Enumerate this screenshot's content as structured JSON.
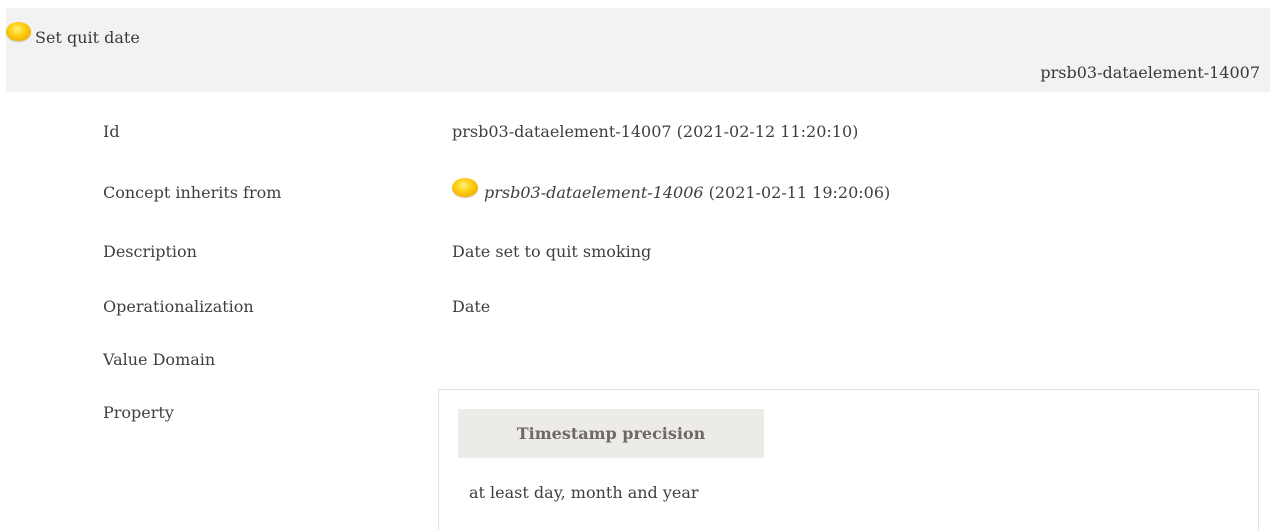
{
  "header": {
    "title": "Set quit date",
    "icon": "status-dot-icon",
    "icon_color": "#ffd21a",
    "ref_id": "prsb03-dataelement-14007"
  },
  "fields": {
    "id": {
      "label": "Id",
      "value": "prsb03-dataelement-14007 (2021-02-12 11:20:10)"
    },
    "inherits": {
      "label": "Concept inherits from",
      "ref_id": "prsb03-dataelement-14006",
      "ref_date": "(2021-02-11 19:20:06)"
    },
    "description": {
      "label": "Description",
      "value": "Date set to quit smoking"
    },
    "operationalization": {
      "label": "Operationalization",
      "value": "Date"
    },
    "value_domain": {
      "label": "Value Domain"
    },
    "property": {
      "label": "Property",
      "header": "Timestamp precision",
      "value": "at least day, month and year"
    }
  }
}
